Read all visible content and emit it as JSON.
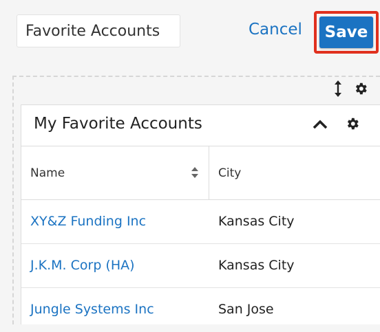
{
  "header": {
    "dashboard_name_value": "Favorite Accounts",
    "cancel_label": "Cancel",
    "save_label": "Save"
  },
  "dashlet": {
    "title": "My Favorite Accounts",
    "columns": [
      "Name",
      "City"
    ],
    "rows": [
      {
        "name": "XY&Z Funding Inc",
        "city": "Kansas City"
      },
      {
        "name": "J.K.M. Corp (HA)",
        "city": "Kansas City"
      },
      {
        "name": "Jungle Systems Inc",
        "city": "San Jose"
      }
    ]
  },
  "icons": {
    "resize": "resize-vertical-icon",
    "settings": "gear-icon",
    "collapse": "chevron-up-icon",
    "sort": "sort-icon"
  },
  "colors": {
    "link": "#1b73c2",
    "save_button": "#1b73c2",
    "highlight_outline": "#e0301e"
  }
}
